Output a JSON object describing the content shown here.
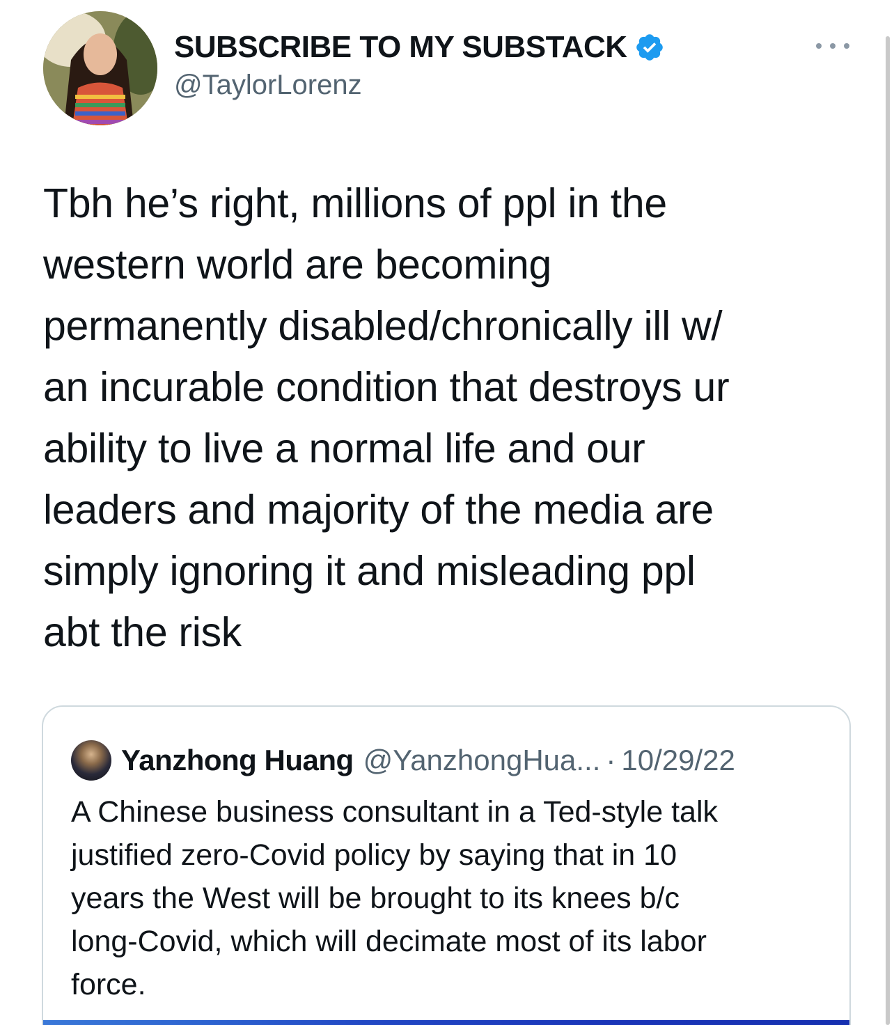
{
  "tweet": {
    "display_name": "SUBSCRIBE TO MY SUBSTACK",
    "handle": "@TaylorLorenz",
    "text": "Tbh he’s right, millions of ppl in the\nwestern world are becoming\npermanently disabled/chronically ill w/\nan incurable condition that destroys ur\nability to live a normal life and our\nleaders and majority of the media are\nsimply ignoring it and misleading ppl\nabt the risk",
    "verified_color": "#1d9bf0",
    "more_icon": "more-horizontal-icon"
  },
  "quoted_tweet": {
    "display_name": "Yanzhong Huang",
    "handle": "@YanzhongHua...",
    "separator": "·",
    "date": "10/29/22",
    "text": "A Chinese business consultant in a Ted-style talk\njustified zero-Covid policy by saying that in 10\nyears the West will be brought to its knees b/c\nlong-Covid, which will decimate most of its labor\nforce."
  }
}
